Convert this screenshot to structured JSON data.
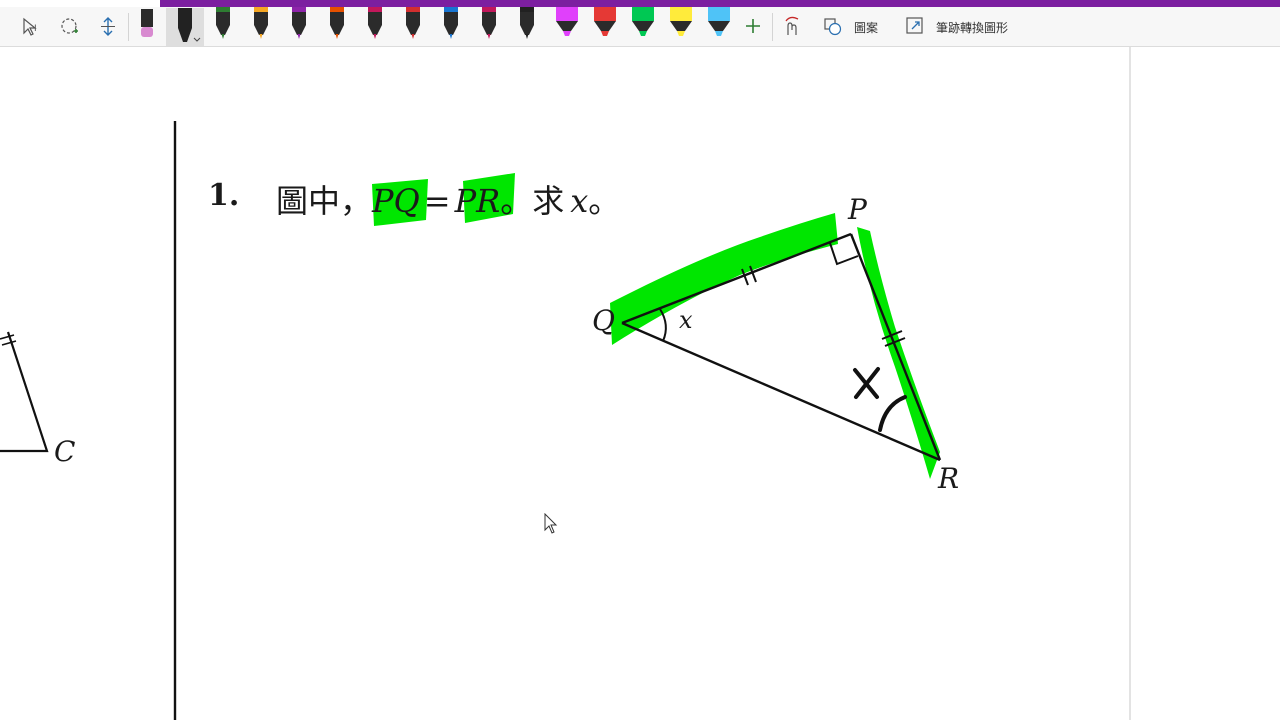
{
  "toolbar": {
    "shapes_label": "圖案",
    "ink_to_shape_label": "筆跡轉換圖形",
    "icons": [
      "type-select-icon",
      "lasso-select-icon",
      "insert-space-icon",
      "eraser-icon",
      "black-pen-icon",
      "add-pen-icon",
      "touch-draw-icon",
      "shapes-icon",
      "ink-to-shape-icon"
    ],
    "pen_colors": [
      "#2e7d32",
      "#f5a623",
      "#8e24aa",
      "#e65100",
      "#c2185b",
      "#d32f2f",
      "#1976d2",
      "#c2185b",
      "#212121"
    ],
    "highlighter_colors": [
      "#e040fb",
      "#e53935",
      "#00c853",
      "#ffeb3b",
      "#4fc3f7"
    ]
  },
  "question": {
    "number": "1.",
    "text_prefix": "圖中，",
    "pq": "PQ",
    "equals": "=",
    "pr": "PR",
    "text_mid": "。求",
    "var": "x",
    "text_end": "。"
  },
  "figure": {
    "label_p": "P",
    "label_q": "Q",
    "label_r": "R",
    "angle_label": "x"
  },
  "left_figure": {
    "label_c": "C"
  },
  "colors": {
    "accent": "#7c1fa0",
    "highlight": "#00e600",
    "ink": "#111111"
  }
}
